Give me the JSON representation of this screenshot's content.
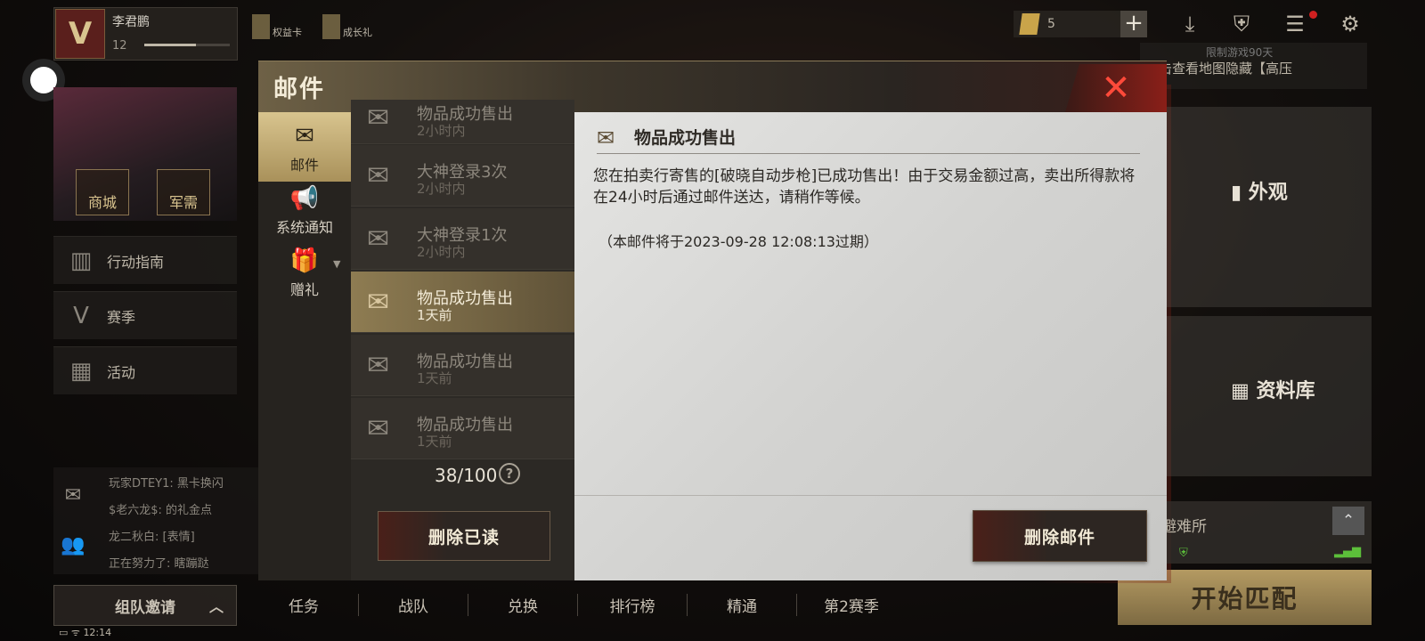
{
  "player": {
    "name": "李君鹏",
    "level": "12",
    "level_progress": 0.6
  },
  "top_links": [
    {
      "label": "权益卡",
      "icon": "card-icon"
    },
    {
      "label": "成长礼",
      "icon": "gift-icon"
    }
  ],
  "currency": {
    "amount": "5"
  },
  "banner": {
    "text": "点击查看地图隐藏【高压",
    "small": "限制游戏90天"
  },
  "left_promo": {
    "shop": "商城",
    "armory": "军需"
  },
  "side_menu": [
    {
      "label": "行动指南",
      "icon": "map-icon"
    },
    {
      "label": "赛季",
      "icon": "season-icon"
    },
    {
      "label": "活动",
      "icon": "gift-icon"
    }
  ],
  "chat": [
    "玩家DTEY1: 黑卡换闪",
    "$老六龙$: 的礼金点",
    "龙二秋白: [表情]",
    "正在努力了: 瞎蹦跶"
  ],
  "team_invite": "组队邀请",
  "status_time": "12:14",
  "bottom_tabs": [
    "任务",
    "战队",
    "兑换",
    "排行榜",
    "精通",
    "第2赛季"
  ],
  "start_match": "开始匹配",
  "right_cards": {
    "appearance": "外观",
    "library": "资料库",
    "shelter": "避难所"
  },
  "dialog": {
    "title": "邮件",
    "categories": [
      {
        "label": "邮件",
        "icon": "mail-icon",
        "active": true
      },
      {
        "label": "系统通知",
        "icon": "megaphone-icon",
        "active": false
      },
      {
        "label": "赠礼",
        "icon": "gift-icon",
        "active": false
      }
    ],
    "mails": [
      {
        "title": "物品成功售出",
        "time": "2小时内",
        "active": false
      },
      {
        "title": "大神登录3次",
        "time": "2小时内",
        "active": false
      },
      {
        "title": "大神登录1次",
        "time": "2小时内",
        "active": false
      },
      {
        "title": "物品成功售出",
        "time": "1天前",
        "active": true
      },
      {
        "title": "物品成功售出",
        "time": "1天前",
        "active": false
      },
      {
        "title": "物品成功售出",
        "time": "1天前",
        "active": false
      }
    ],
    "count": "38/100",
    "delete_read": "删除已读",
    "detail": {
      "title": "物品成功售出",
      "body": "您在拍卖行寄售的[破晓自动步枪]已成功售出！由于交易金额过高，卖出所得款将在24小时后通过邮件送达，请稍作等候。",
      "expiry": "（本邮件将于2023-09-28 12:08:13过期）"
    },
    "delete_mail": "删除邮件"
  }
}
